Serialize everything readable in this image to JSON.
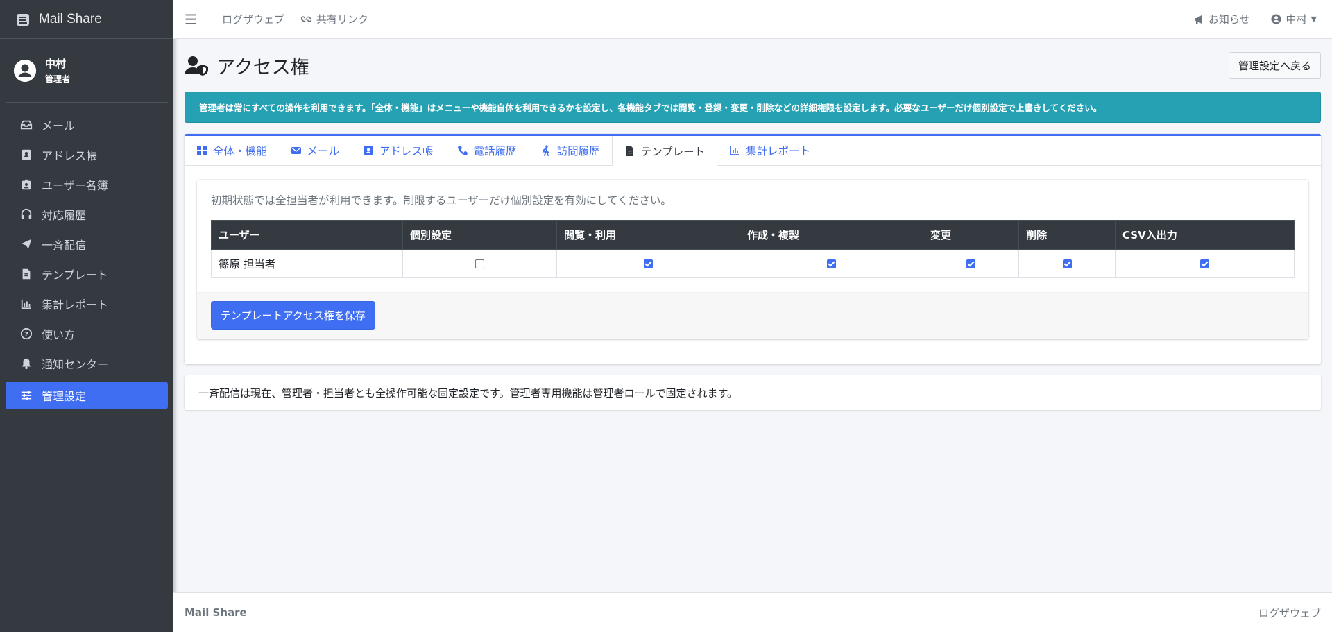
{
  "sidebar": {
    "brand": "Mail Share",
    "user": {
      "name": "中村",
      "role": "管理者"
    },
    "items": [
      {
        "label": "メール",
        "icon": "inbox-icon"
      },
      {
        "label": "アドレス帳",
        "icon": "address-book-icon"
      },
      {
        "label": "ユーザー名簿",
        "icon": "id-badge-icon"
      },
      {
        "label": "対応履歴",
        "icon": "headset-icon"
      },
      {
        "label": "一斉配信",
        "icon": "paper-plane-icon"
      },
      {
        "label": "テンプレート",
        "icon": "file-text-icon"
      },
      {
        "label": "集計レポート",
        "icon": "chart-bar-icon"
      },
      {
        "label": "使い方",
        "icon": "question-circle-icon"
      },
      {
        "label": "通知センター",
        "icon": "bell-icon"
      },
      {
        "label": "管理設定",
        "icon": "sliders-icon",
        "active": true
      }
    ]
  },
  "topbar": {
    "links": [
      "ログザウェブ",
      "共有リンク"
    ],
    "notice": "お知らせ",
    "user": "中村"
  },
  "page": {
    "title": "アクセス権",
    "back_button": "管理設定へ戻る",
    "alert": "管理者は常にすべての操作を利用できます。「全体・機能」はメニューや機能自体を利用できるかを設定し、各機能タブでは閲覧・登録・変更・削除などの詳細権限を設定します。必要なユーザーだけ個別設定で上書きしてください。"
  },
  "tabs": [
    {
      "label": "全体・機能",
      "icon": "grid-icon"
    },
    {
      "label": "メール",
      "icon": "envelope-icon"
    },
    {
      "label": "アドレス帳",
      "icon": "address-book-icon"
    },
    {
      "label": "電話履歴",
      "icon": "phone-icon"
    },
    {
      "label": "訪問履歴",
      "icon": "walking-icon"
    },
    {
      "label": "テンプレート",
      "icon": "file-text-icon",
      "active": true
    },
    {
      "label": "集計レポート",
      "icon": "chart-bar-icon"
    }
  ],
  "panel": {
    "description": "初期状態では全担当者が利用できます。制限するユーザーだけ個別設定を有効にしてください。",
    "columns": [
      "ユーザー",
      "個別設定",
      "閲覧・利用",
      "作成・複製",
      "変更",
      "削除",
      "CSV入出力"
    ],
    "rows": [
      {
        "user": "篠原 担当者",
        "checks": [
          false,
          true,
          true,
          true,
          true,
          true
        ]
      }
    ],
    "save_button": "テンプレートアクセス権を保存"
  },
  "note": "一斉配信は現在、管理者・担当者とも全操作可能な固定設定です。管理者専用機能は管理者ロールで固定されます。",
  "footer": {
    "brand": "Mail Share",
    "link": "ログザウェブ"
  },
  "colors": {
    "accent": "#3f6ef2",
    "sidebar": "#343a40",
    "alert": "#26a1b3"
  }
}
